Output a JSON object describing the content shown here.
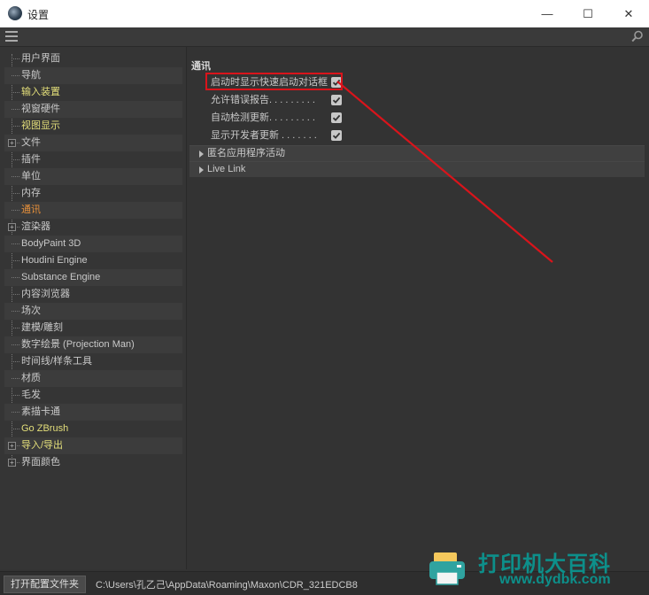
{
  "window": {
    "title": "设置",
    "controls": {
      "minimize": "—",
      "maximize": "☐",
      "close": "✕"
    }
  },
  "sidebar": {
    "items": [
      {
        "label": "用户界面",
        "style": "normal",
        "expandable": false
      },
      {
        "label": "导航",
        "style": "normal",
        "expandable": false
      },
      {
        "label": "输入装置",
        "style": "highlight",
        "expandable": false
      },
      {
        "label": "视窗硬件",
        "style": "normal",
        "expandable": false
      },
      {
        "label": "视图显示",
        "style": "highlight",
        "expandable": false
      },
      {
        "label": "文件",
        "style": "normal",
        "expandable": true
      },
      {
        "label": "插件",
        "style": "normal",
        "expandable": false
      },
      {
        "label": "单位",
        "style": "normal",
        "expandable": false
      },
      {
        "label": "内存",
        "style": "normal",
        "expandable": false
      },
      {
        "label": "通讯",
        "style": "active",
        "expandable": false
      },
      {
        "label": "渲染器",
        "style": "normal",
        "expandable": true
      },
      {
        "label": "BodyPaint 3D",
        "style": "normal",
        "expandable": false
      },
      {
        "label": "Houdini Engine",
        "style": "normal",
        "expandable": false
      },
      {
        "label": "Substance Engine",
        "style": "normal",
        "expandable": false
      },
      {
        "label": "内容浏览器",
        "style": "normal",
        "expandable": false
      },
      {
        "label": "场次",
        "style": "normal",
        "expandable": false
      },
      {
        "label": "建模/雕刻",
        "style": "normal",
        "expandable": false
      },
      {
        "label": "数字绘景 (Projection Man)",
        "style": "normal",
        "expandable": false
      },
      {
        "label": "时间线/样条工具",
        "style": "normal",
        "expandable": false
      },
      {
        "label": "材质",
        "style": "normal",
        "expandable": false
      },
      {
        "label": "毛发",
        "style": "normal",
        "expandable": false
      },
      {
        "label": "素描卡通",
        "style": "normal",
        "expandable": false
      },
      {
        "label": "Go ZBrush",
        "style": "highlight",
        "expandable": false
      },
      {
        "label": "导入/导出",
        "style": "highlight",
        "expandable": true
      },
      {
        "label": "界面颜色",
        "style": "normal",
        "expandable": true
      }
    ]
  },
  "main": {
    "section_title": "通讯",
    "options": [
      {
        "label": "启动时显示快速启动对话框",
        "checked": true
      },
      {
        "label": "允许错误报告. . . . . . . . .",
        "checked": true
      },
      {
        "label": "自动检测更新. . . . . . . . .",
        "checked": true
      },
      {
        "label": "显示开发者更新 . . . . . . .",
        "checked": true
      }
    ],
    "groups": [
      {
        "label": "匿名应用程序活动"
      },
      {
        "label": "Live Link"
      }
    ]
  },
  "statusbar": {
    "open_button": "打开配置文件夹",
    "path": "C:\\Users\\孔乙己\\AppData\\Roaming\\Maxon\\CDR_321EDCB8"
  },
  "watermark": {
    "line1": "打印机大百科",
    "line2": "www.dydbk.com"
  },
  "colors": {
    "highlight_text": "#e4df7a",
    "active_text": "#e8913a",
    "annotation": "#d9141b",
    "watermark": "#0d8f8a"
  }
}
